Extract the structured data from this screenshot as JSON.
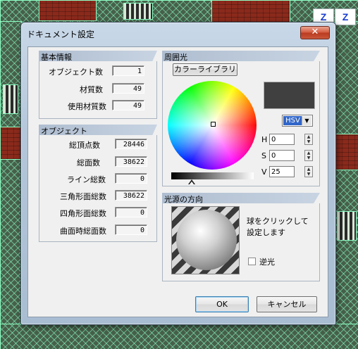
{
  "dialog": {
    "title": "ドキュメント設定",
    "close_glyph": "✕"
  },
  "viewport": {
    "axis_buttons": [
      "Z",
      "Z"
    ]
  },
  "basic_info": {
    "heading": "基本情報",
    "rows": [
      {
        "label": "オブジェクト数",
        "value": "1"
      },
      {
        "label": "材質数",
        "value": "49"
      },
      {
        "label": "使用材質数",
        "value": "49"
      }
    ]
  },
  "object_info": {
    "heading": "オブジェクト",
    "rows": [
      {
        "label": "総頂点数",
        "value": "28446"
      },
      {
        "label": "総面数",
        "value": "38622"
      },
      {
        "label": "ライン総数",
        "value": "0"
      },
      {
        "label": "三角形面総数",
        "value": "38622"
      },
      {
        "label": "四角形面総数",
        "value": "0"
      },
      {
        "label": "曲面時総面数",
        "value": "0"
      }
    ]
  },
  "ambient": {
    "heading": "周囲光",
    "color_library_label": "カラーライブラリ",
    "swatch_color": "#404040",
    "mode_selected": "HSV",
    "dropdown_glyph": "▼",
    "h_label": "H",
    "s_label": "S",
    "v_label": "V",
    "h_value": "0",
    "s_value": "0",
    "v_value": "25",
    "brightness_level": 0.25
  },
  "light_direction": {
    "heading": "光源の方向",
    "hint_line1": "球をクリックして",
    "hint_line2": "設定します",
    "backlight_label": "逆光",
    "backlight_checked": false
  },
  "footer": {
    "ok_label": "OK",
    "cancel_label": "キャンセル"
  }
}
